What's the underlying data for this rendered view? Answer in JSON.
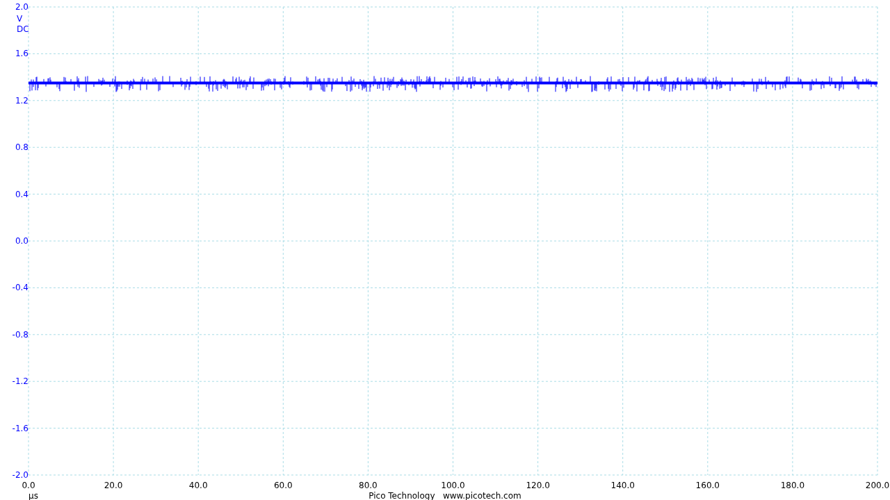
{
  "chart_data": {
    "type": "line",
    "xlabel": "µs",
    "ylabel": "V",
    "x": [
      0,
      200
    ],
    "series": [
      {
        "color": "#0000ff",
        "values": [
          1.35,
          1.35
        ]
      }
    ],
    "xlim": [
      0,
      200
    ],
    "ylim": [
      -2,
      2
    ],
    "grid": true,
    "xticks": [
      {
        "value": 0,
        "label": "0.0"
      },
      {
        "value": 20,
        "label": "20.0"
      },
      {
        "value": 40,
        "label": "40.0"
      },
      {
        "value": 60,
        "label": "60.0"
      },
      {
        "value": 80,
        "label": "80.0"
      },
      {
        "value": 100,
        "label": "100.0"
      },
      {
        "value": 120,
        "label": "120.0"
      },
      {
        "value": 140,
        "label": "140.0"
      },
      {
        "value": 160,
        "label": "160.0"
      },
      {
        "value": 180,
        "label": "180.0"
      },
      {
        "value": 200,
        "label": "200.0"
      }
    ],
    "yticks": [
      {
        "value": 2,
        "label": "2.0"
      },
      {
        "value": 1.6,
        "label": "1.6"
      },
      {
        "value": 1.2,
        "label": "1.2"
      },
      {
        "value": 0.8,
        "label": "0.8"
      },
      {
        "value": 0.4,
        "label": "0.4"
      },
      {
        "value": 0,
        "label": "0.0"
      },
      {
        "value": -0.4,
        "label": "-0.4"
      },
      {
        "value": -0.8,
        "label": "-0.8"
      },
      {
        "value": -1.2,
        "label": "-1.2"
      },
      {
        "value": -1.6,
        "label": "-1.6"
      },
      {
        "value": -2,
        "label": "-2.0"
      }
    ]
  },
  "coupling": "DC",
  "footer": "Pico Technology   www.picotech.com"
}
